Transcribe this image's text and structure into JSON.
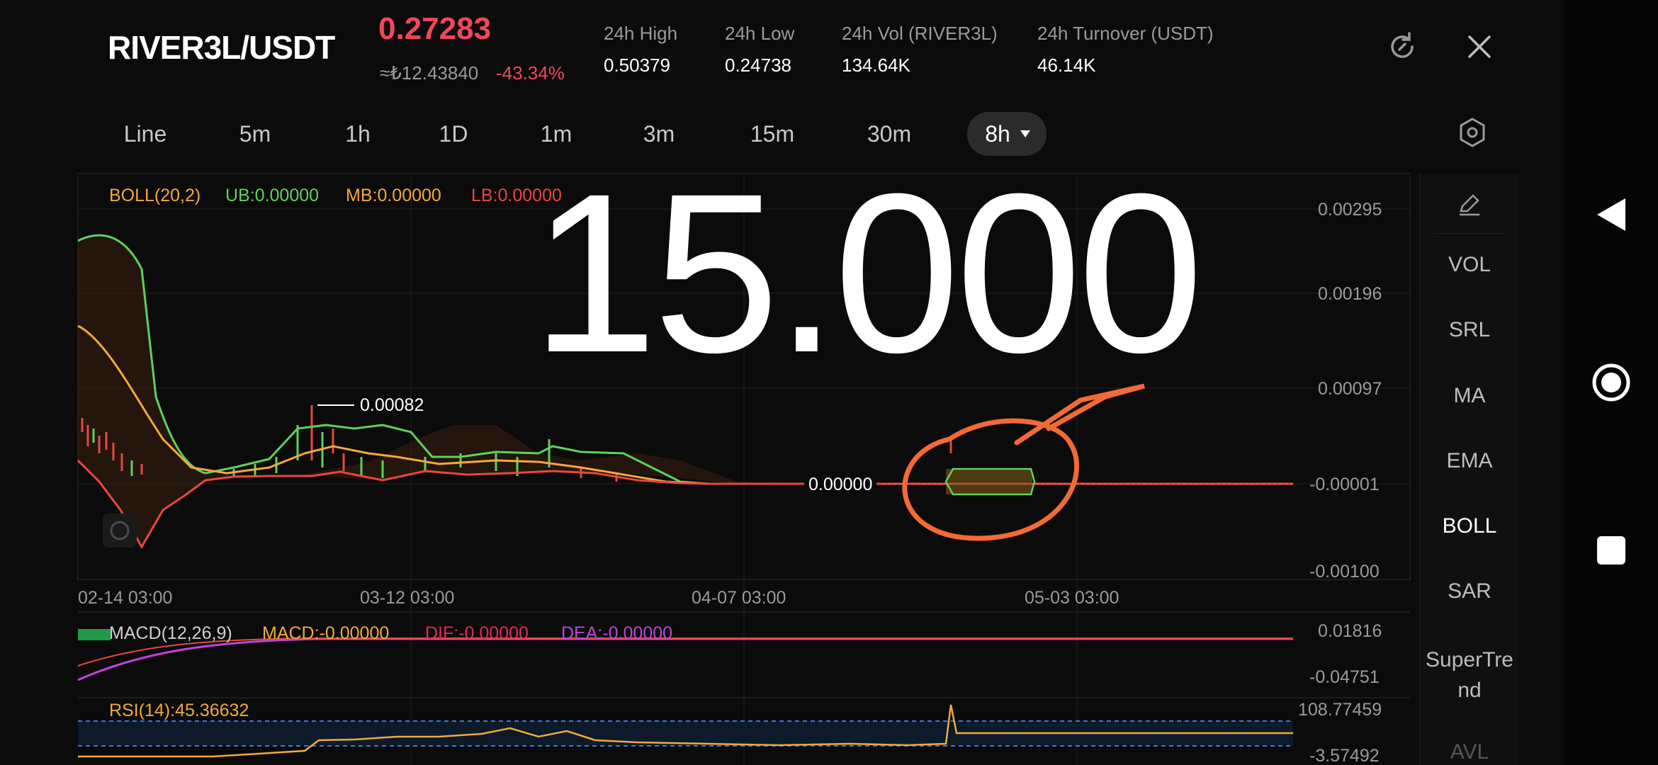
{
  "header": {
    "pair": "RIVER3L/USDT",
    "price": "0.27283",
    "fiat": "≈₺12.43840",
    "change": "-43.34%",
    "stats": [
      {
        "label": "24h   High",
        "value": "0.50379"
      },
      {
        "label": "24h   Low",
        "value": "0.24738"
      },
      {
        "label": "24h   Vol (RIVER3L)",
        "value": "134.64K"
      },
      {
        "label": "24h   Turnover (USDT)",
        "value": "46.14K"
      }
    ]
  },
  "timeframes": [
    "Line",
    "5m",
    "1h",
    "1D",
    "1m",
    "3m",
    "15m",
    "30m",
    "8h"
  ],
  "active_timeframe": "8h",
  "overlay_text": "15.000",
  "chart": {
    "boll": {
      "title": "BOLL(20,2)",
      "ub": "UB:0.00000",
      "mb": "MB:0.00000",
      "lb": "LB:0.00000"
    },
    "price_axis": [
      "0.00295",
      "0.00196",
      "0.00097",
      "-0.00001",
      "-0.00100"
    ],
    "time_axis": [
      "02-14 03:00",
      "03-12 03:00",
      "04-07 03:00",
      "05-03 03:00"
    ],
    "high_marker": "0.00082",
    "last_marker": "0.00000",
    "macd": {
      "title": "MACD(12,26,9)",
      "macd": "MACD:-0.00000",
      "dif": "DIF:-0.00000",
      "dea": "DEA:-0.00000",
      "axis": [
        "0.01816",
        "-0.04751"
      ]
    },
    "rsi": {
      "title": "RSI(14):45.36632",
      "axis": [
        "108.77459",
        "-3.57492"
      ]
    }
  },
  "indicators": [
    "VOL",
    "SRL",
    "MA",
    "EMA",
    "BOLL",
    "SAR",
    "SuperTrend",
    "AVL"
  ],
  "active_indicator": "BOLL",
  "colors": {
    "accent_red": "#f0475a",
    "boll_mb": "#f2a93b",
    "boll_ub": "#5fd15a",
    "boll_lb": "#e8473d",
    "macd_dea": "#c044d8",
    "annotation": "#f26a35"
  }
}
